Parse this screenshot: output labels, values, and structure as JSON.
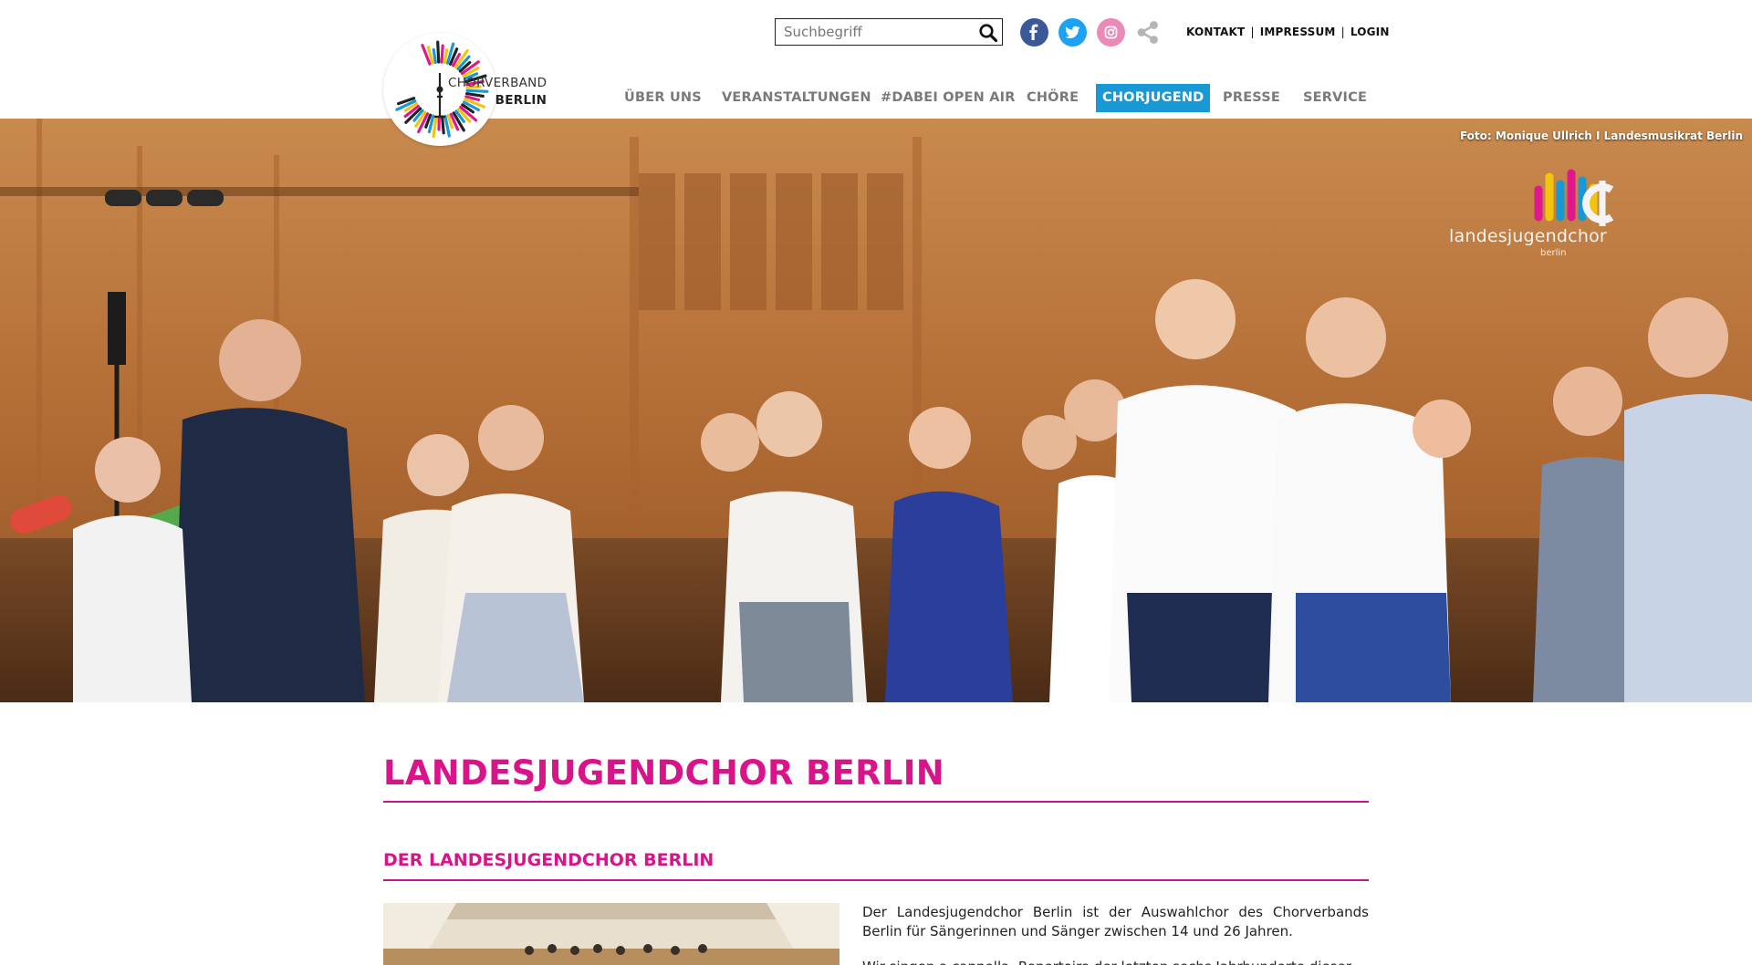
{
  "logo": {
    "line1": "CHORVERBAND",
    "line2": "BERLIN"
  },
  "search": {
    "placeholder": "Suchbegriff",
    "value": ""
  },
  "social": [
    {
      "name": "facebook",
      "icon": "facebook-icon",
      "color": "#3b5998"
    },
    {
      "name": "twitter",
      "icon": "twitter-icon",
      "color": "#1da1f2"
    },
    {
      "name": "instagram",
      "icon": "instagram-icon",
      "color": "#e98bb6"
    },
    {
      "name": "share",
      "icon": "share-icon",
      "color": "#b5b5b5"
    }
  ],
  "toplinks": {
    "kontakt": "KONTAKT",
    "separator": "|",
    "impressum": "IMPRESSUM",
    "login": "LOGIN"
  },
  "nav": {
    "items": [
      {
        "label": "ÜBER UNS",
        "active": false
      },
      {
        "label": "VERANSTALTUNGEN",
        "active": false
      },
      {
        "label": "#DABEI OPEN AIR",
        "active": false
      },
      {
        "label": "CHÖRE",
        "active": false
      },
      {
        "label": "CHORJUGEND",
        "active": true
      },
      {
        "label": "PRESSE",
        "active": false
      },
      {
        "label": "SERVICE",
        "active": false
      }
    ]
  },
  "hero": {
    "credit": "Foto: Monique Ullrich I Landesmusikrat Berlin",
    "logo_word": "landesjugendchor",
    "logo_sub": "berlin"
  },
  "content": {
    "title": "LANDESJUGENDCHOR BERLIN",
    "subtitle": "DER LANDESJUGENDCHOR BERLIN",
    "paragraph": "Der Landesjugendchor Berlin ist der Auswahlchor des Chorverbands Berlin für Sängerinnen und Sänger zwischen 14 und 26 Jahren.",
    "paragraph2": "Wir singen a cappella, Repertoire der letzten sechs Jahrhunderte dieser Stadt"
  },
  "colors": {
    "accent_magenta": "#d9138a",
    "nav_active": "#1898d5",
    "nav_text": "#7a7a7a"
  }
}
